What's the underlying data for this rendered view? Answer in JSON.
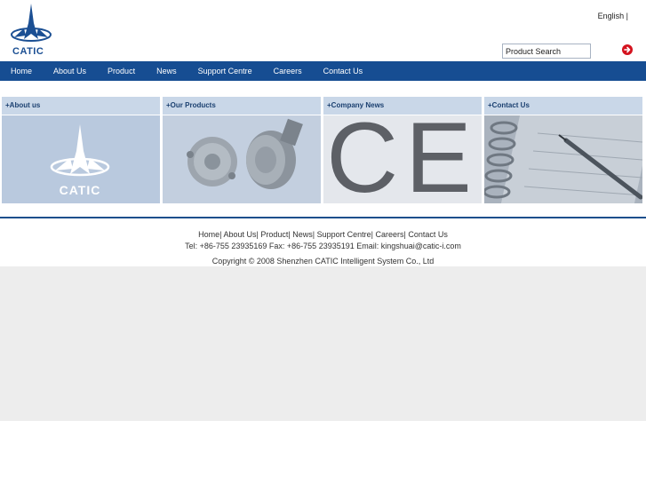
{
  "header": {
    "logo_text": "CATIC",
    "language": "English |",
    "search_placeholder": "Product Search",
    "search_go_icon": "arrow-right-circle-icon",
    "accent_color": "#d4121e"
  },
  "nav": {
    "background": "#164d92",
    "items": [
      {
        "label": "Home"
      },
      {
        "label": "About Us"
      },
      {
        "label": "Product"
      },
      {
        "label": "News"
      },
      {
        "label": "Support Centre"
      },
      {
        "label": "Careers"
      },
      {
        "label": "Contact Us"
      }
    ]
  },
  "panels": [
    {
      "title": "+About us",
      "image": "catic-logo",
      "caption": "CATIC"
    },
    {
      "title": "+Our Products",
      "image": "pressure-switch-devices"
    },
    {
      "title": "+Company News",
      "image": "ce-mark",
      "caption": "CE"
    },
    {
      "title": "+Contact Us",
      "image": "notebook-and-pen"
    }
  ],
  "footer": {
    "links": [
      {
        "label": "Home|"
      },
      {
        "label": "About Us|"
      },
      {
        "label": "Product|"
      },
      {
        "label": "News|"
      },
      {
        "label": "Support Centre|"
      },
      {
        "label": "Careers|"
      },
      {
        "label": "Contact Us"
      }
    ],
    "contact": "Tel: +86-755 23935169 Fax: +86-755 23935191 Email: kingshuai@catic-i.com",
    "copyright": "Copyright © 2008 Shenzhen CATIC Intelligent System Co., Ltd"
  }
}
